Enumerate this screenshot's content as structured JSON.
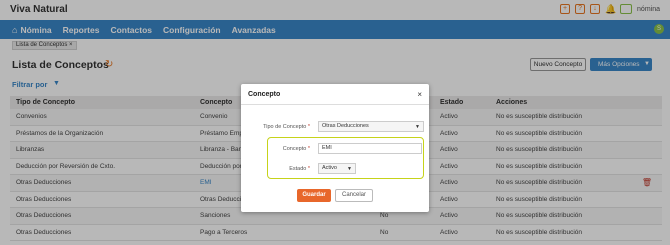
{
  "app": {
    "title": "Viva Natural",
    "user_name": "nómina",
    "user_badge": "S"
  },
  "header_icons": [
    "plus-icon",
    "help-icon",
    "download-icon",
    "bell-icon"
  ],
  "nav": {
    "items": [
      "Nómina",
      "Reportes",
      "Contactos",
      "Configuración",
      "Avanzadas"
    ]
  },
  "breadcrumb": {
    "tab": "Lista de Conceptos ×"
  },
  "page": {
    "title": "Lista de Conceptos",
    "filter_label": "Filtrar por",
    "new_button": "Nuevo Concepto",
    "more_button": "Más Opciones"
  },
  "table": {
    "headers": [
      "Tipo de Concepto",
      "Concepto",
      "",
      "Estado",
      "Acciones",
      ""
    ],
    "rows": [
      [
        "Convenios",
        "Convenio",
        "",
        "Activo",
        "No es susceptible distribución"
      ],
      [
        "Préstamos de la Organización",
        "Préstamo Emp",
        "",
        "Activo",
        "No es susceptible distribución"
      ],
      [
        "Libranzas",
        "Libranza - Banc",
        "",
        "Activo",
        "No es susceptible distribución"
      ],
      [
        "Deducción por Reversión de Cxto.",
        "Deducción por",
        "",
        "Activo",
        "No es susceptible distribución"
      ],
      [
        "Otras Deducciones",
        "EMI",
        "",
        "Activo",
        "No es susceptible distribución"
      ],
      [
        "Otras Deducciones",
        "Otras Deducci",
        "",
        "Activo",
        "No es susceptible distribución"
      ],
      [
        "Otras Deducciones",
        "Sanciones",
        "No",
        "Activo",
        "No es susceptible distribución"
      ],
      [
        "Otras Deducciones",
        "Pago a Terceros",
        "No",
        "Activo",
        "No es susceptible distribución"
      ]
    ]
  },
  "modal": {
    "title": "Concepto",
    "close": "×",
    "tipo_label": "Tipo de Concepto",
    "tipo_value": "Otras Deducciones",
    "concepto_label": "Concepto",
    "concepto_value": "EMI",
    "estado_label": "Estado",
    "estado_value": "Activo",
    "required_mark": "*",
    "save_button": "Guardar",
    "cancel_button": "Cancelar"
  },
  "colors": {
    "nav_blue": "#3a87c8",
    "accent_orange": "#e8672b",
    "highlight_lime": "#c6d31a",
    "delete_red": "#c0392b"
  }
}
